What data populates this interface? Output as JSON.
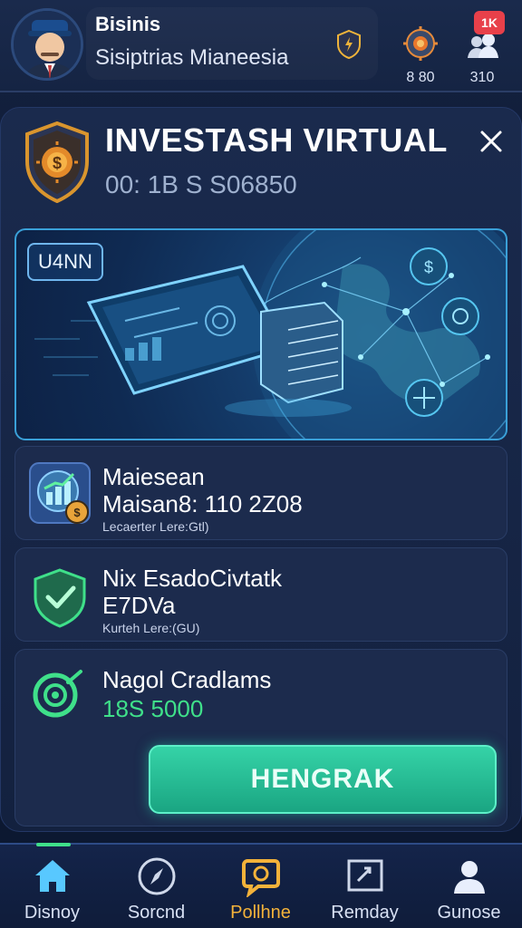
{
  "header": {
    "user_name": "Bisinis",
    "subtitle": "Sisiptrias Mianeesia",
    "stats": [
      {
        "icon": "sun-gear-icon",
        "value": "8 80"
      },
      {
        "icon": "user-group-icon",
        "value": "310"
      }
    ],
    "notification_badge": "1K"
  },
  "card": {
    "title": "INVESTASH VIRTUAL",
    "code": "00: 1B S S06850",
    "close_icon": "close-icon"
  },
  "banner": {
    "tag": "U4NN"
  },
  "rows": [
    {
      "title": "Maiesean",
      "value": "Maisan8: 110 2Z08",
      "note": "Lecaerter Lere:Gtl)",
      "icon": "chart-coin-icon"
    },
    {
      "title": "Nix EsadoCivtatk",
      "value": "E7DVa",
      "note": "Kurteh Lere:(GU)",
      "icon": "shield-check-icon"
    },
    {
      "title": "Nagol Cradlams",
      "value": "18S 5000",
      "icon": "target-icon"
    }
  ],
  "cta": {
    "label": "HENGRAK"
  },
  "nav": [
    {
      "label": "Disnoy",
      "icon": "home-icon"
    },
    {
      "label": "Sorcnd",
      "icon": "compass-icon"
    },
    {
      "label": "Pollhne",
      "icon": "chat-bubble-icon"
    },
    {
      "label": "Remday",
      "icon": "flag-board-icon"
    },
    {
      "label": "Gunose",
      "icon": "user-icon"
    }
  ],
  "colors": {
    "background": "#0f1a33",
    "accent_green": "#3fe08a",
    "cta": "#26c29a",
    "active_nav": "#f3b23a",
    "notification": "#e8404a",
    "banner_border": "#3aa0d8"
  }
}
